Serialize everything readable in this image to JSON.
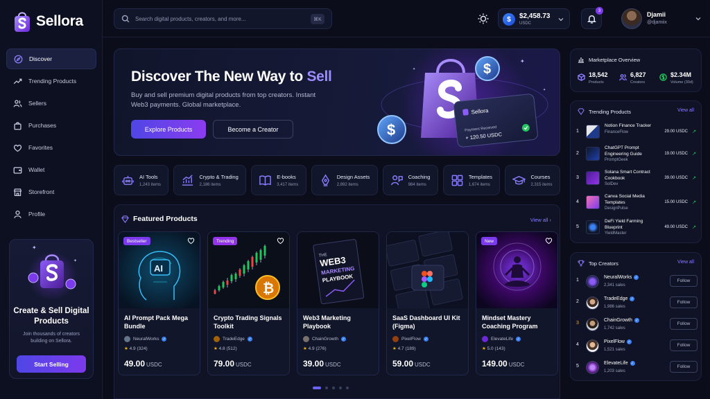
{
  "brand": {
    "name": "Sellora"
  },
  "sidebar": {
    "items": [
      {
        "label": "Discover",
        "icon": "compass-icon"
      },
      {
        "label": "Trending Products",
        "icon": "trend-icon"
      },
      {
        "label": "Sellers",
        "icon": "users-icon"
      },
      {
        "label": "Purchases",
        "icon": "bag-icon"
      },
      {
        "label": "Favorites",
        "icon": "heart-icon"
      },
      {
        "label": "Wallet",
        "icon": "wallet-icon"
      },
      {
        "label": "Storefront",
        "icon": "store-icon"
      },
      {
        "label": "Profile",
        "icon": "user-icon"
      }
    ],
    "promo": {
      "title": "Create & Sell Digital Products",
      "subtitle": "Join thousands of creators building on Sellora.",
      "button": "Start Selling"
    }
  },
  "topbar": {
    "search_placeholder": "Search digital products, creators, and more...",
    "shortcut": "⌘K",
    "wallet": {
      "amount": "$2,458.73",
      "currency": "USDC"
    },
    "notifications": "3",
    "user": {
      "name": "Djamii",
      "handle": "@djamiix"
    }
  },
  "hero": {
    "title_main": "Discover The New Way to ",
    "title_highlight": "Sell",
    "subtitle": "Buy and sell premium digital products from top creators. Instant Web3 payments. Global marketplace.",
    "primary_button": "Explore Products",
    "secondary_button": "Become a Creator",
    "card": {
      "brand": "Sellora",
      "label": "Payment Received",
      "amount": "+ 120.50 USDC"
    }
  },
  "categories": [
    {
      "name": "AI Tools",
      "count": "1,243 items",
      "icon": "robot-icon"
    },
    {
      "name": "Crypto & Trading",
      "count": "2,186 items",
      "icon": "chart-icon"
    },
    {
      "name": "E-books",
      "count": "3,417 items",
      "icon": "book-icon"
    },
    {
      "name": "Design Assets",
      "count": "2,892 items",
      "icon": "pen-tool-icon"
    },
    {
      "name": "Coaching",
      "count": "984 items",
      "icon": "coach-icon"
    },
    {
      "name": "Templates",
      "count": "1,674 items",
      "icon": "grid-icon"
    },
    {
      "name": "Courses",
      "count": "2,315 items",
      "icon": "graduation-cap-icon"
    }
  ],
  "featured": {
    "title": "Featured Products",
    "view_all": "View all",
    "products": [
      {
        "title": "AI Prompt Pack Mega Bundle",
        "author": "NeuralWorks",
        "rating": "4.9",
        "reviews": "(324)",
        "price": "49.00",
        "currency": "USDC",
        "badge": "Bestseller",
        "badge_color": "#7c3aed"
      },
      {
        "title": "Crypto Trading Signals Toolkit",
        "author": "TradeEdge",
        "rating": "4.8",
        "reviews": "(512)",
        "price": "79.00",
        "currency": "USDC",
        "badge": "Trending",
        "badge_color": "#9333ea"
      },
      {
        "title": "Web3 Marketing Playbook",
        "author": "ChainGrowth",
        "rating": "4.9",
        "reviews": "(276)",
        "price": "39.00",
        "currency": "USDC",
        "badge": "",
        "book_text": "THE WEB3 MARKETING PLAYBOOK"
      },
      {
        "title": "SaaS Dashboard UI Kit (Figma)",
        "author": "PixelFlow",
        "rating": "4.7",
        "reviews": "(189)",
        "price": "59.00",
        "currency": "USDC",
        "badge": ""
      },
      {
        "title": "Mindset Mastery Coaching Program",
        "author": "ElevateLife",
        "rating": "5.0",
        "reviews": "(143)",
        "price": "149.00",
        "currency": "USDC",
        "badge": "New",
        "badge_color": "#7c3aed"
      }
    ],
    "pager": {
      "pages": 5,
      "active": 1
    }
  },
  "overview": {
    "title": "Marketplace Overview",
    "stats": [
      {
        "value": "18,542",
        "label": "Products"
      },
      {
        "value": "6,827",
        "label": "Creators"
      },
      {
        "value": "$2.34M",
        "label": "Volume (30d)"
      }
    ]
  },
  "trending": {
    "title": "Trending Products",
    "view_all": "View all",
    "items": [
      {
        "rank": "1",
        "title": "Notion Finance Tracker",
        "author": "FinanceFlow",
        "price": "29.00 USDC"
      },
      {
        "rank": "2",
        "title": "ChatGPT Prompt Engineering Guide",
        "author": "PromptGeek",
        "price": "19.00 USDC"
      },
      {
        "rank": "3",
        "title": "Solana Smart Contract Cookbook",
        "author": "SolDev",
        "price": "39.00 USDC"
      },
      {
        "rank": "4",
        "title": "Canva Social Media Templates",
        "author": "DesignPulse",
        "price": "15.00 USDC"
      },
      {
        "rank": "5",
        "title": "DeFi Yield Farming Blueprint",
        "author": "YieldMaster",
        "price": "49.00 USDC"
      }
    ]
  },
  "creators": {
    "title": "Top Creators",
    "view_all": "View all",
    "items": [
      {
        "rank": "1",
        "name": "NeuralWorks",
        "sales": "2,341 sales",
        "button": "Follow"
      },
      {
        "rank": "2",
        "name": "TradeEdge",
        "sales": "1,986 sales",
        "button": "Follow"
      },
      {
        "rank": "3",
        "name": "ChainGrowth",
        "sales": "1,742 sales",
        "button": "Follow"
      },
      {
        "rank": "4",
        "name": "PixelFlow",
        "sales": "1,521 sales",
        "button": "Follow"
      },
      {
        "rank": "5",
        "name": "ElevateLife",
        "sales": "1,203 sales",
        "button": "Follow"
      }
    ]
  }
}
